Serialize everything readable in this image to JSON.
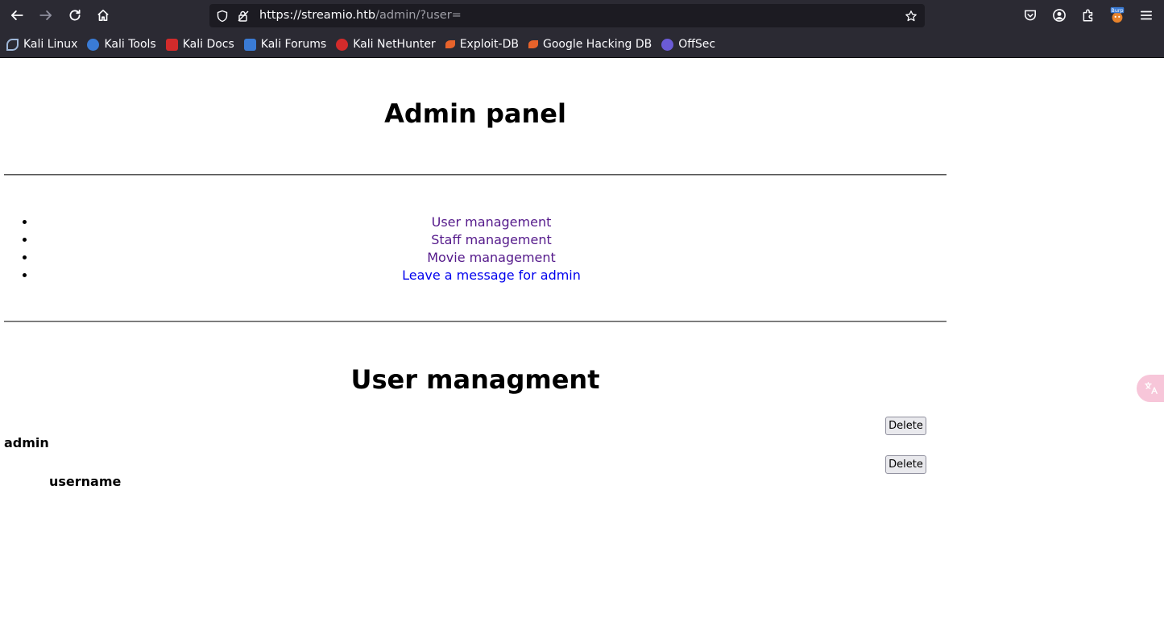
{
  "browser": {
    "url_host": "https://streamio.htb",
    "url_path": "/admin/?user=",
    "extension_badge": "Burp",
    "bookmarks": [
      {
        "label": "Kali Linux",
        "color": "#4a9bd6"
      },
      {
        "label": "Kali Tools",
        "color": "#3a7bd5"
      },
      {
        "label": "Kali Docs",
        "color": "#d22b2b"
      },
      {
        "label": "Kali Forums",
        "color": "#3a7bd5"
      },
      {
        "label": "Kali NetHunter",
        "color": "#d22b2b"
      },
      {
        "label": "Exploit-DB",
        "color": "#e8632b"
      },
      {
        "label": "Google Hacking DB",
        "color": "#e8632b"
      },
      {
        "label": "OffSec",
        "color": "#6b5bd6"
      }
    ]
  },
  "page": {
    "title": "Admin panel",
    "menu": [
      {
        "label": "User management",
        "visited": true
      },
      {
        "label": "Staff management",
        "visited": true
      },
      {
        "label": "Movie management",
        "visited": true
      },
      {
        "label": "Leave a message for admin",
        "visited": false
      }
    ],
    "section_title": "User managment",
    "users": [
      {
        "name": "admin",
        "action": "Delete"
      },
      {
        "name": "username",
        "action": "Delete"
      }
    ],
    "translate_icon": "translate-icon"
  },
  "colors": {
    "chrome_bg": "#2b2a33",
    "urlbar_bg": "#1c1b22",
    "link_visited": "#551a8b",
    "link_unvisited": "#0000ee"
  }
}
